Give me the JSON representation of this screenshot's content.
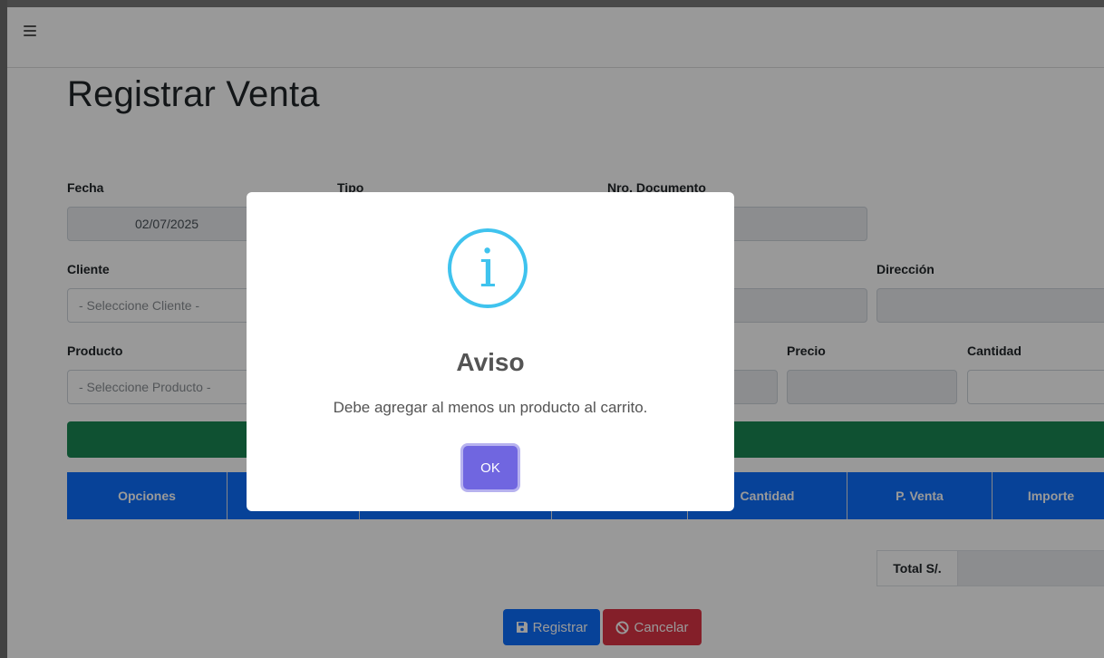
{
  "page": {
    "title": "Registrar Venta"
  },
  "form": {
    "fecha_label": "Fecha",
    "fecha_value": "02/07/2025",
    "tipo_label": "Tipo",
    "nro_documento_label": "Nro. Documento",
    "cliente_label": "Cliente",
    "cliente_placeholder": "- Seleccione Cliente -",
    "direccion_label": "Dirección",
    "producto_label": "Producto",
    "producto_placeholder": "- Seleccione Producto -",
    "precio_label": "Precio",
    "cantidad_label": "Cantidad"
  },
  "table": {
    "headers": [
      "Opciones",
      "",
      "",
      "",
      "Cantidad",
      "P. Venta",
      "Importe"
    ]
  },
  "totals": {
    "label": "Total S/."
  },
  "buttons": {
    "registrar": "Registrar",
    "cancelar": "Cancelar"
  },
  "modal": {
    "title": "Aviso",
    "message": "Debe agregar al menos un producto al carrito.",
    "ok": "OK"
  },
  "colors": {
    "primary": "#0d6efd",
    "success": "#198754",
    "danger": "#dc3545",
    "info": "#3fc3ee",
    "confirm": "#7066e0"
  }
}
